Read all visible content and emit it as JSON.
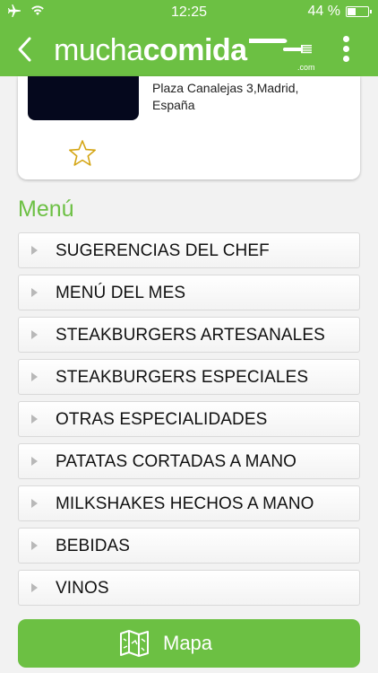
{
  "status_bar": {
    "time": "12:25",
    "battery_text": "44 %",
    "battery_level": 0.44,
    "icons": [
      "airplane-icon",
      "wifi-icon",
      "battery-icon"
    ]
  },
  "header": {
    "logo_part1": "mucha",
    "logo_part2": "comida",
    "logo_suffix": ".com",
    "icons": [
      "back-chevron-icon",
      "fork-knife-icon",
      "more-vertical-icon"
    ]
  },
  "restaurant": {
    "address_line1": "Plaza Canalejas 3,Madrid,",
    "address_line2": "España",
    "favorite_icon": "star-outline-icon"
  },
  "menu": {
    "title": "Menú",
    "items": [
      "SUGERENCIAS DEL CHEF",
      "MENÚ DEL MES",
      "STEAKBURGERS ARTESANALES",
      "STEAKBURGERS ESPECIALES",
      "OTRAS ESPECIALIDADES",
      "PATATAS CORTADAS A MANO",
      "MILKSHAKES HECHOS A MANO",
      "BEBIDAS",
      "VINOS"
    ]
  },
  "map_button": {
    "label": "Mapa",
    "icon": "map-icon"
  },
  "colors": {
    "brand_green": "#6cc043",
    "star_outline": "#d4a514",
    "image_dark": "#05081d"
  }
}
